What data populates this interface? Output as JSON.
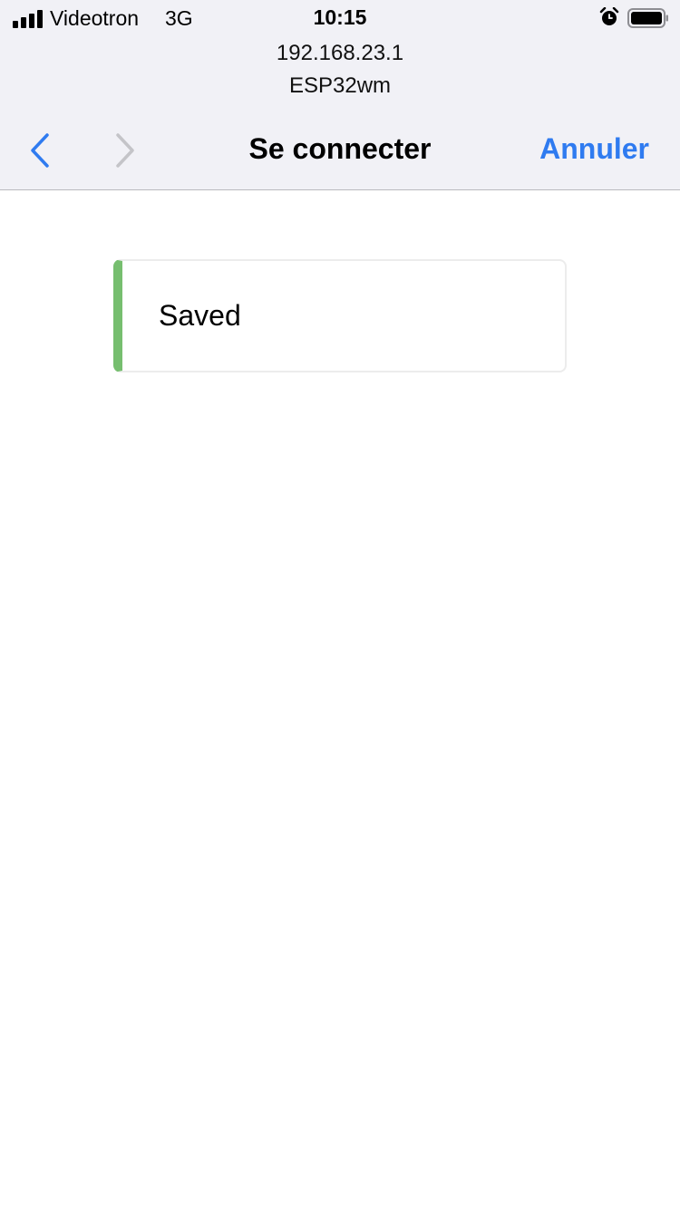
{
  "status_bar": {
    "carrier": "Videotron",
    "network": "3G",
    "time": "10:15",
    "icons": [
      "signal-icon",
      "alarm-icon",
      "battery-icon"
    ]
  },
  "address": {
    "host": "192.168.23.1",
    "ssid": "ESP32wm"
  },
  "nav": {
    "title": "Se connecter",
    "cancel_label": "Annuler",
    "back_icon": "chevron-left-icon",
    "forward_icon": "chevron-right-icon"
  },
  "content": {
    "message": "Saved"
  },
  "colors": {
    "accent": "#2f7bf0",
    "success": "#76be6f",
    "bar_background": "#f1f1f6"
  }
}
